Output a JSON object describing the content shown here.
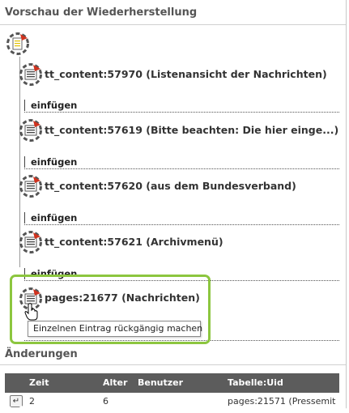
{
  "preview": {
    "title": "Vorschau der Wiederherstellung",
    "items": [
      {
        "label": "tt_content:57970 (Listenansicht der Nachrichten)",
        "icon": "content-record-icon",
        "action": "einfügen"
      },
      {
        "label": "tt_content:57619 (Bitte beachten: Die hier einge...)",
        "icon": "content-record-icon",
        "action": "einfügen"
      },
      {
        "label": "tt_content:57620 (aus dem Bundesverband)",
        "icon": "content-record-icon",
        "action": "einfügen"
      },
      {
        "label": "tt_content:57621 (Archivmenü)",
        "icon": "content-record-icon",
        "action": "einfügen"
      },
      {
        "label": "pages:21677 (Nachrichten)",
        "icon": "page-record-icon"
      }
    ],
    "root_icon": "page-root-icon",
    "tooltip": "Einzelnen Eintrag rückgängig machen"
  },
  "changes": {
    "title": "Änderungen",
    "columns": [
      "Zeit",
      "Alter",
      "Benutzer",
      "Tabelle:Uid"
    ],
    "rows": [
      {
        "zeit": "2",
        "alter": "6",
        "benutzer": "",
        "tabelle": "pages:21571 (Pressemit"
      }
    ]
  },
  "colors": {
    "highlight": "#8cc63f",
    "table_header": "#5c5c5c",
    "icon_red": "#d0321e"
  }
}
